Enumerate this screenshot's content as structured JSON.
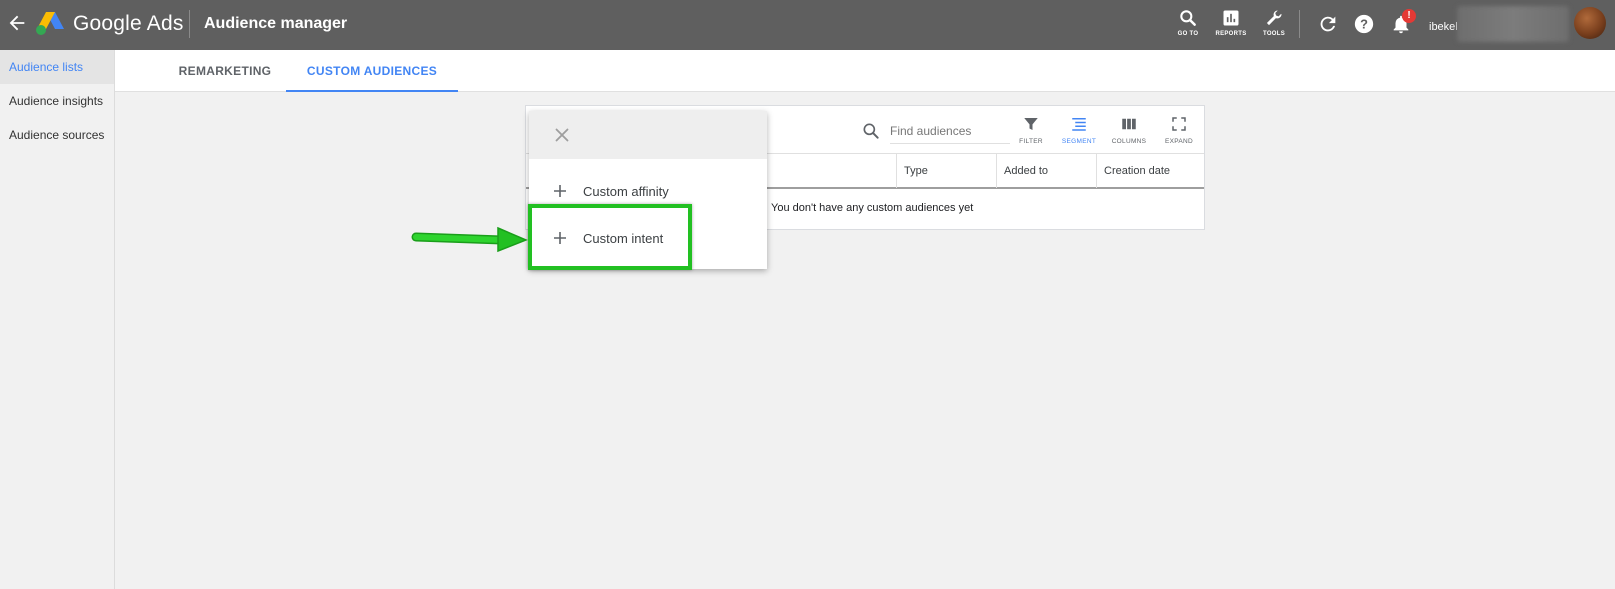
{
  "header": {
    "brand": "Google Ads",
    "page_title": "Audience manager",
    "actions": [
      {
        "label": "GO TO",
        "icon": "search-icon"
      },
      {
        "label": "REPORTS",
        "icon": "reports-icon"
      },
      {
        "label": "TOOLS",
        "icon": "wrench-icon"
      }
    ],
    "notification_count": "!",
    "username": "ibekel"
  },
  "sidebar": {
    "items": [
      {
        "label": "Audience lists",
        "active": true
      },
      {
        "label": "Audience insights",
        "active": false
      },
      {
        "label": "Audience sources",
        "active": false
      }
    ]
  },
  "tabs": [
    {
      "label": "REMARKETING",
      "active": false
    },
    {
      "label": "CUSTOM AUDIENCES",
      "active": true
    }
  ],
  "table": {
    "search_placeholder": "Find audiences",
    "tools": [
      {
        "label": "FILTER",
        "active": false
      },
      {
        "label": "SEGMENT",
        "active": true
      },
      {
        "label": "COLUMNS",
        "active": false
      },
      {
        "label": "EXPAND",
        "active": false
      }
    ],
    "columns": [
      "Type",
      "Added to",
      "Creation date"
    ],
    "empty_message": "You don't have any custom audiences yet"
  },
  "menu": {
    "items": [
      {
        "label": "Custom affinity"
      },
      {
        "label": "Custom intent"
      }
    ]
  },
  "colors": {
    "topbar": "#5f5f5f",
    "accent": "#4285f4",
    "highlight": "#22c022"
  }
}
